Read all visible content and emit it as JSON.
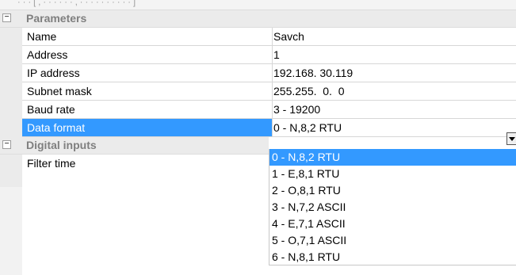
{
  "top_strip_text": "· · · [ , · · · · · · , · · · · · · · · · · ]",
  "categories": [
    {
      "label": "Parameters",
      "toggle": "−"
    },
    {
      "label": "Digital inputs",
      "toggle": "−"
    }
  ],
  "parameters": [
    {
      "name": "Name",
      "value": "Savch"
    },
    {
      "name": "Address",
      "value": "1"
    },
    {
      "name": "IP address",
      "value": "192.168. 30.119"
    },
    {
      "name": "Subnet mask",
      "value": "255.255.  0.  0"
    },
    {
      "name": "Baud rate",
      "value": "3 - 19200"
    },
    {
      "name": "Data format",
      "value": "0 - N,8,2 RTU"
    }
  ],
  "digital_inputs": [
    {
      "name": "Filter time",
      "value": ""
    }
  ],
  "data_format_options": [
    "0 - N,8,2 RTU",
    "1 - E,8,1 RTU",
    "2 - O,8,1 RTU",
    "3 - N,7,2 ASCII",
    "4 - E,7,1 ASCII",
    "5 - O,7,1 ASCII",
    "6 - N,8,1 RTU"
  ],
  "selected_option_index": 0,
  "colors": {
    "selection": "#3399ff",
    "category_bg": "#ebebeb",
    "category_text": "#7f7f7f",
    "grid_line": "#d7d7d7"
  },
  "icons": {
    "collapse": "minus-box-icon",
    "dropdown": "chevron-down-icon"
  }
}
